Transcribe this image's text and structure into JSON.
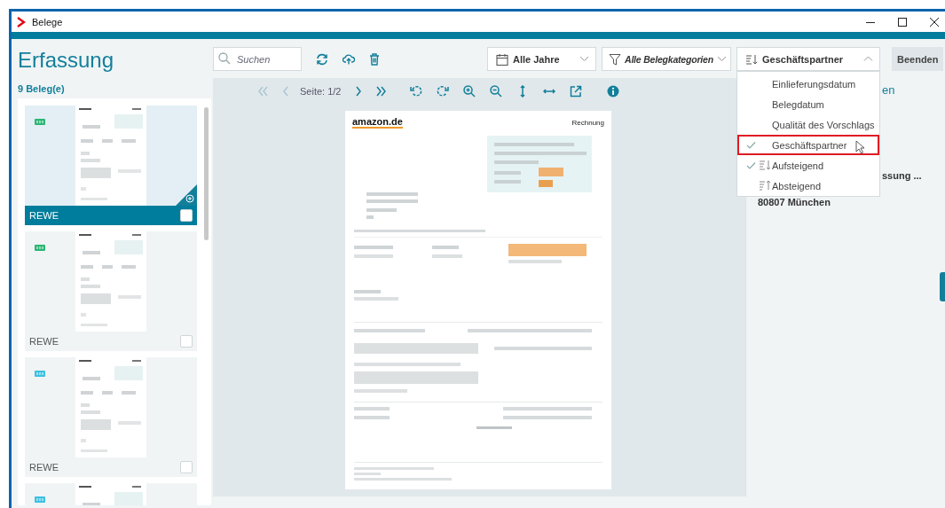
{
  "window": {
    "title": "Belege"
  },
  "sidebar": {
    "heading": "Erfassung",
    "count": "9 Beleg(e)",
    "cards": [
      {
        "name": "REWE",
        "selected": true,
        "checked": false,
        "color": "#2bb673"
      },
      {
        "name": "REWE",
        "selected": false,
        "checked": false,
        "color": "#2bb673"
      },
      {
        "name": "REWE",
        "selected": false,
        "checked": false,
        "color": "#3cc0e0"
      },
      {
        "selected": false,
        "color": "#3cc0e0"
      }
    ]
  },
  "toolbar": {
    "search": {
      "placeholder": "Suchen"
    },
    "dropdowns": [
      {
        "kind": "calendar",
        "label": "Alle Jahre",
        "expanded": false
      },
      {
        "kind": "filter",
        "label": "Alle Belegkategorien",
        "expanded": false
      },
      {
        "kind": "sort",
        "label": "Geschäftspartner",
        "expanded": true
      }
    ],
    "close_button": "Beenden"
  },
  "sort_menu": {
    "items": [
      {
        "kind": "field",
        "label": "Einlieferungsdatum",
        "checked": false,
        "highlighted": false
      },
      {
        "kind": "field",
        "label": "Belegdatum",
        "checked": false,
        "highlighted": false
      },
      {
        "kind": "field",
        "label": "Qualität des Vorschlags",
        "checked": false,
        "highlighted": false
      },
      {
        "kind": "field",
        "label": "Geschäftspartner",
        "checked": true,
        "highlighted": true
      },
      {
        "kind": "ascending",
        "label": "Aufsteigend",
        "checked": true,
        "highlighted": false
      },
      {
        "kind": "descending",
        "label": "Absteigend",
        "checked": false,
        "highlighted": false
      }
    ]
  },
  "viewer": {
    "nav": [
      {
        "kind": "first",
        "disabled": true
      },
      {
        "kind": "prev",
        "disabled": true
      }
    ],
    "page_label": "Seite: 1/2",
    "nav_after": [
      {
        "kind": "next",
        "disabled": false
      },
      {
        "kind": "last",
        "disabled": false
      }
    ],
    "document": {
      "logo": "amazon.de",
      "title": "Rechnung"
    }
  },
  "details": {
    "lines": [
      {
        "kind": "link_fragment",
        "text": "en"
      },
      {
        "kind": "fragment",
        "text": "ssung ..."
      },
      {
        "kind": "text",
        "text": "80807 München"
      }
    ]
  }
}
